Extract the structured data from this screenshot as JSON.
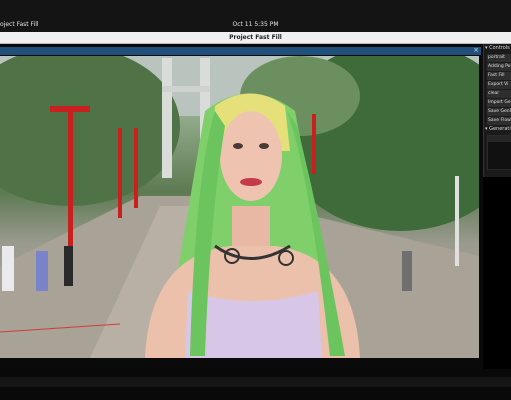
{
  "menubar": {
    "app_name": "oject Fast Fill",
    "clock": "Oct 11  5:35 PM"
  },
  "window": {
    "title": "Project Fast Fill"
  },
  "viewport": {
    "close_glyph": "×"
  },
  "controls": {
    "header": "▾ Controls",
    "buttons": [
      {
        "label": "portrait"
      },
      {
        "label": "Adding Po"
      },
      {
        "label": "Fast Fill"
      },
      {
        "label": "Export Vi"
      },
      {
        "label": "clear"
      },
      {
        "label": "Import Gen"
      },
      {
        "label": "Save GenF"
      },
      {
        "label": "Save Flow"
      }
    ]
  },
  "generations": {
    "header": "▾ Generati"
  },
  "colors": {
    "viewport_header": "#1f4f7a",
    "panel_bg": "#1b1b1b",
    "hair_green": "#7fcf6a",
    "hair_yellow": "#e6e07a",
    "top_lilac": "#d8c6e6",
    "lamp_red": "#c8201e"
  }
}
